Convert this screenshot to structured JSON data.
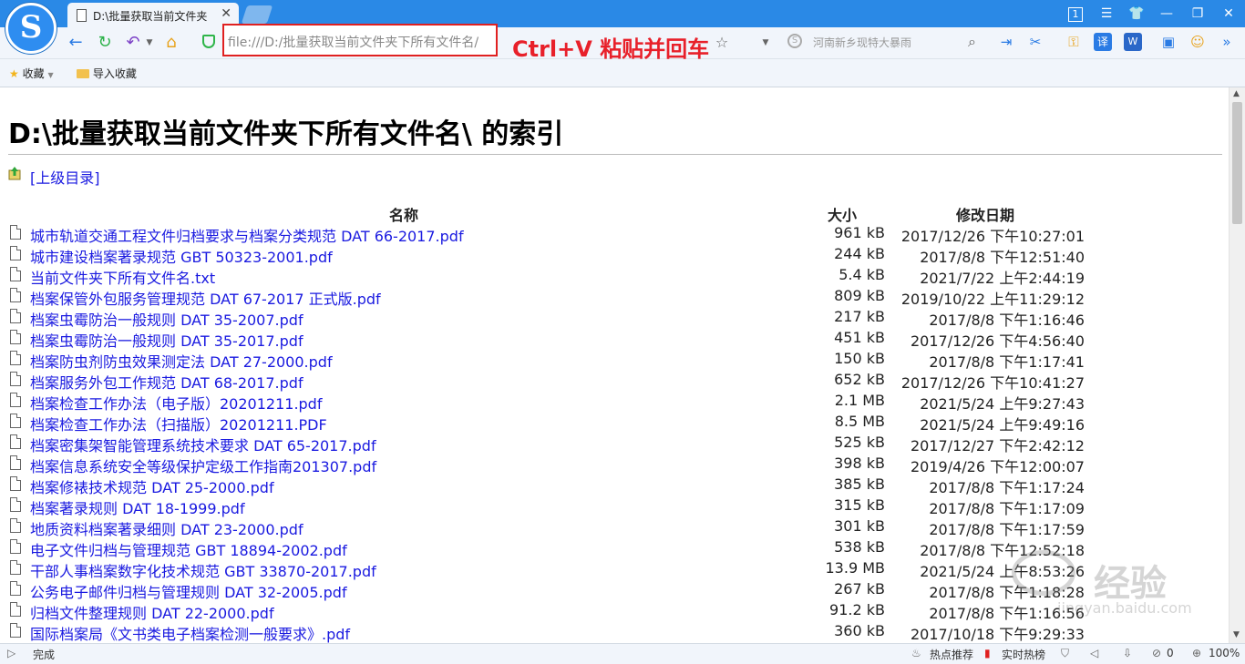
{
  "window": {
    "tab_title": "D:\\批量获取当前文件夹",
    "tab_close": "✕",
    "tab_count": "1"
  },
  "navbar": {
    "address": "file:///D:/批量获取当前文件夹下所有文件名/",
    "search_placeholder": "河南新乡现特大暴雨"
  },
  "annotation": "Ctrl+V 粘贴并回车",
  "bookmarks": {
    "favorites_label": "收藏",
    "import_label": "导入收藏"
  },
  "page": {
    "title": "D:\\批量获取当前文件夹下所有文件名\\ 的索引",
    "parent_link": "[上级目录]",
    "headers": {
      "name": "名称",
      "size": "大小",
      "date": "修改日期"
    },
    "files": [
      {
        "name": "城市轨道交通工程文件归档要求与档案分类规范 DAT 66-2017.pdf",
        "size": "961 kB",
        "date": "2017/12/26 下午10:27:01"
      },
      {
        "name": "城市建设档案著录规范 GBT 50323-2001.pdf",
        "size": "244 kB",
        "date": "2017/8/8 下午12:51:40"
      },
      {
        "name": "当前文件夹下所有文件名.txt",
        "size": "5.4 kB",
        "date": "2021/7/22 上午2:44:19"
      },
      {
        "name": "档案保管外包服务管理规范 DAT 67-2017 正式版.pdf",
        "size": "809 kB",
        "date": "2019/10/22 上午11:29:12"
      },
      {
        "name": "档案虫霉防治一般规则 DAT 35-2007.pdf",
        "size": "217 kB",
        "date": "2017/8/8 下午1:16:46"
      },
      {
        "name": "档案虫霉防治一般规则 DAT 35-2017.pdf",
        "size": "451 kB",
        "date": "2017/12/26 下午4:56:40"
      },
      {
        "name": "档案防虫剂防虫效果测定法 DAT 27-2000.pdf",
        "size": "150 kB",
        "date": "2017/8/8 下午1:17:41"
      },
      {
        "name": "档案服务外包工作规范 DAT 68-2017.pdf",
        "size": "652 kB",
        "date": "2017/12/26 下午10:41:27"
      },
      {
        "name": "档案检查工作办法（电子版）20201211.pdf",
        "size": "2.1 MB",
        "date": "2021/5/24 上午9:27:43"
      },
      {
        "name": "档案检查工作办法（扫描版）20201211.PDF",
        "size": "8.5 MB",
        "date": "2021/5/24 上午9:49:16"
      },
      {
        "name": "档案密集架智能管理系统技术要求 DAT 65-2017.pdf",
        "size": "525 kB",
        "date": "2017/12/27 下午2:42:12"
      },
      {
        "name": "档案信息系统安全等级保护定级工作指南201307.pdf",
        "size": "398 kB",
        "date": "2019/4/26 下午12:00:07"
      },
      {
        "name": "档案修裱技术规范 DAT 25-2000.pdf",
        "size": "385 kB",
        "date": "2017/8/8 下午1:17:24"
      },
      {
        "name": "档案著录规则 DAT 18-1999.pdf",
        "size": "315 kB",
        "date": "2017/8/8 下午1:17:09"
      },
      {
        "name": "地质资料档案著录细则 DAT 23-2000.pdf",
        "size": "301 kB",
        "date": "2017/8/8 下午1:17:59"
      },
      {
        "name": "电子文件归档与管理规范 GBT 18894-2002.pdf",
        "size": "538 kB",
        "date": "2017/8/8 下午12:52:18"
      },
      {
        "name": "干部人事档案数字化技术规范 GBT 33870-2017.pdf",
        "size": "13.9 MB",
        "date": "2021/5/24 上午8:53:26"
      },
      {
        "name": "公务电子邮件归档与管理规则 DAT 32-2005.pdf",
        "size": "267 kB",
        "date": "2017/8/8 下午1:18:28"
      },
      {
        "name": "归档文件整理规则 DAT 22-2000.pdf",
        "size": "91.2 kB",
        "date": "2017/8/8 下午1:16:56"
      },
      {
        "name": "国际档案局《文书类电子档案检测一般要求》.pdf",
        "size": "360 kB",
        "date": "2017/10/18 下午9:29:33"
      }
    ]
  },
  "statusbar": {
    "status": "完成",
    "hot_recommend": "热点推荐",
    "realtime_hot": "实时热榜",
    "count": "0",
    "zoom": "100%"
  },
  "watermark": {
    "text": "经验",
    "url": "jingyan.baidu.com"
  }
}
